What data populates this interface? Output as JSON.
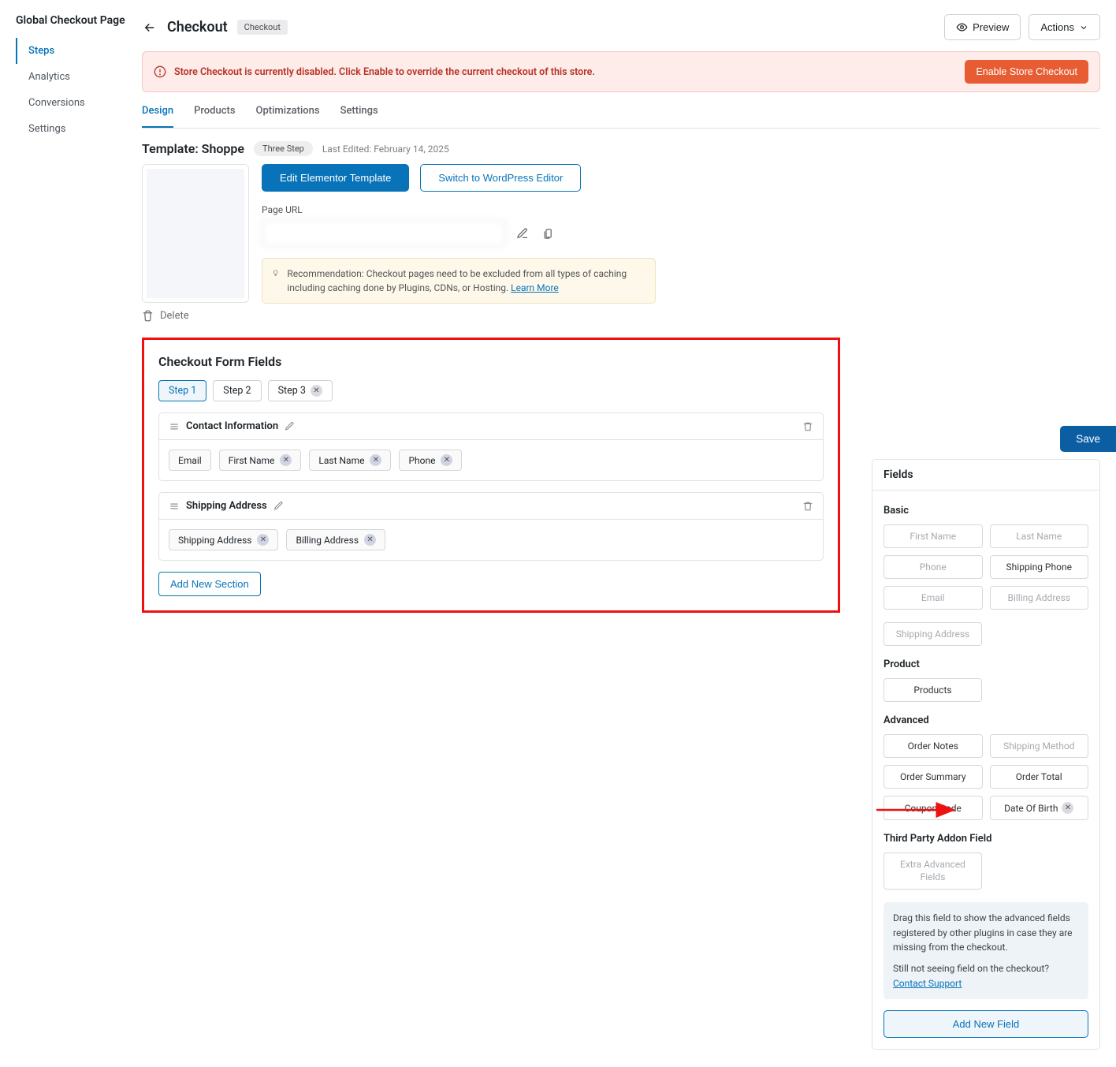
{
  "sidebar": {
    "title": "Global Checkout Page",
    "items": [
      "Steps",
      "Analytics",
      "Conversions",
      "Settings"
    ]
  },
  "header": {
    "title": "Checkout",
    "badge": "Checkout",
    "preview": "Preview",
    "actions": "Actions"
  },
  "alert": {
    "text": "Store Checkout is currently disabled. Click Enable to override the current checkout of this store.",
    "button": "Enable Store Checkout"
  },
  "tabs": [
    "Design",
    "Products",
    "Optimizations",
    "Settings"
  ],
  "template": {
    "title": "Template: Shoppe",
    "badge": "Three Step",
    "last_edited": "Last Edited: February 14, 2025",
    "edit_btn": "Edit Elementor Template",
    "switch_btn": "Switch to WordPress Editor",
    "url_label": "Page URL",
    "reco": "Recommendation: Checkout pages need to be excluded from all types of caching including caching done by Plugins, CDNs, or Hosting. ",
    "learn_more": "Learn More",
    "delete": "Delete"
  },
  "form_fields": {
    "title": "Checkout Form Fields",
    "steps": [
      "Step 1",
      "Step 2",
      "Step 3"
    ],
    "sections": [
      {
        "title": "Contact Information",
        "fields": [
          {
            "label": "Email",
            "removable": false
          },
          {
            "label": "First Name",
            "removable": true
          },
          {
            "label": "Last Name",
            "removable": true
          },
          {
            "label": "Phone",
            "removable": true
          }
        ]
      },
      {
        "title": "Shipping Address",
        "fields": [
          {
            "label": "Shipping Address",
            "removable": true
          },
          {
            "label": "Billing Address",
            "removable": true
          }
        ]
      }
    ],
    "add_section": "Add New Section",
    "save": "Save"
  },
  "panel": {
    "title": "Fields",
    "groups": {
      "basic": {
        "title": "Basic",
        "items": [
          {
            "label": "First Name",
            "disabled": true
          },
          {
            "label": "Last Name",
            "disabled": true
          },
          {
            "label": "Phone",
            "disabled": true
          },
          {
            "label": "Shipping Phone",
            "disabled": false
          },
          {
            "label": "Email",
            "disabled": true
          },
          {
            "label": "Billing Address",
            "disabled": true
          },
          {
            "label": "Shipping Address",
            "disabled": true
          }
        ]
      },
      "product": {
        "title": "Product",
        "items": [
          {
            "label": "Products"
          }
        ]
      },
      "advanced": {
        "title": "Advanced",
        "items": [
          {
            "label": "Order Notes"
          },
          {
            "label": "Shipping Method",
            "disabled": true
          },
          {
            "label": "Order Summary"
          },
          {
            "label": "Order Total"
          },
          {
            "label": "Coupon Code"
          },
          {
            "label": "Date Of Birth",
            "removable": true
          }
        ]
      },
      "third": {
        "title": "Third Party Addon Field",
        "items": [
          {
            "label": "Extra Advanced Fields",
            "disabled": true
          }
        ]
      }
    },
    "hint1": "Drag this field to show the advanced fields registered by other plugins in case they are missing from the checkout.",
    "hint2": "Still not seeing field on the checkout?",
    "contact": " Contact Support",
    "add_field": "Add New Field"
  }
}
